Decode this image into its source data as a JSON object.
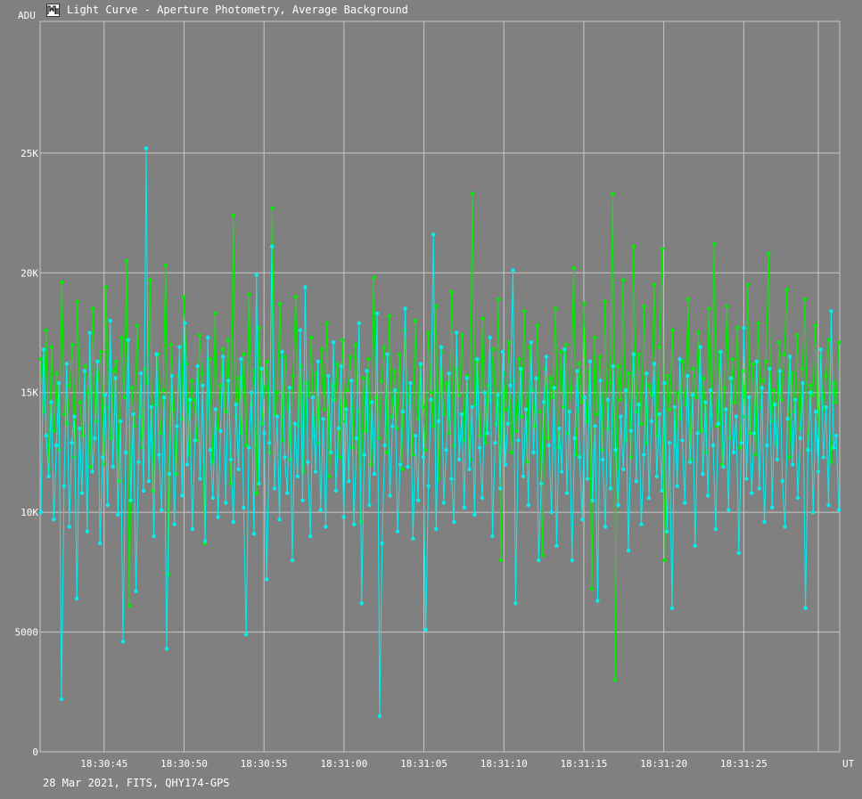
{
  "window": {
    "title": "Light Curve - Aperture Photometry, Average Background",
    "icon": "light-curve-app-icon"
  },
  "footer": {
    "info": "28 Mar 2021, FITS, QHY174-GPS"
  },
  "colors": {
    "background": "#808080",
    "grid": "#c8c8c8",
    "series_green": "#00ee00",
    "series_cyan": "#00f0f0"
  },
  "chart_data": {
    "type": "line",
    "title": "Light Curve - Aperture Photometry, Average Background",
    "ylabel": "ADU",
    "xlabel": "UT",
    "xlim": [
      "18:30:41",
      "18:31:31"
    ],
    "ylim": [
      0,
      30500
    ],
    "grid": true,
    "x_tick_labels": [
      "18:30:45",
      "18:30:50",
      "18:30:55",
      "18:31:00",
      "18:31:05",
      "18:31:10",
      "18:31:15",
      "18:31:20",
      "18:31:25"
    ],
    "y_tick_labels": [
      "0",
      "5000",
      "10K",
      "15K",
      "20K",
      "25K"
    ],
    "y_tick_values": [
      0,
      5000,
      10000,
      15000,
      20000,
      25000
    ],
    "series": [
      {
        "values": [
          16400,
          14200,
          17600,
          11800,
          16900,
          13400,
          15800,
          12600,
          19600,
          14100,
          13700,
          15300,
          17000,
          12300,
          18800,
          14600,
          13200,
          16100,
          15000,
          11900,
          18500,
          13800,
          15600,
          16700,
          12000,
          19400,
          14400,
          13100,
          15900,
          16300,
          11300,
          17300,
          14800,
          20500,
          6100,
          15200,
          13600,
          17800,
          14000,
          12700,
          16000,
          15400,
          19700,
          10900,
          14500,
          16600,
          13300,
          15100,
          20300,
          7400,
          17000,
          14300,
          11600,
          15700,
          13900,
          19000,
          16200,
          12400,
          15500,
          14700,
          13000,
          17400,
          15800,
          8700,
          14600,
          16400,
          12100,
          18300,
          13500,
          15300,
          16800,
          14200,
          17200,
          11200,
          22400,
          14000,
          15600,
          13300,
          16600,
          12800,
          19100,
          14500,
          15900,
          10800,
          17700,
          13700,
          15200,
          16300,
          12500,
          22700,
          14100,
          15000,
          18700,
          13000,
          16500,
          14400,
          12200,
          15700,
          19000,
          13600,
          16100,
          11700,
          15400,
          14900,
          17300,
          13200,
          15800,
          12900,
          16800,
          14300,
          17900,
          11500,
          15300,
          14700,
          16200,
          12300,
          17200,
          13800,
          15100,
          16500,
          12700,
          17000,
          14200,
          9600,
          15600,
          13400,
          16400,
          12000,
          19800,
          14800,
          13100,
          15500,
          16900,
          12500,
          18200,
          14000,
          15900,
          13500,
          16600,
          11800,
          17600,
          14600,
          15200,
          12400,
          18000,
          13900,
          16100,
          14400,
          12600,
          17500,
          15000,
          13600,
          18600,
          11400,
          16700,
          14100,
          15400,
          13300,
          19200,
          12800,
          16000,
          14900,
          17400,
          13000,
          15700,
          12200,
          23300,
          14500,
          16300,
          13200,
          18100,
          12900,
          15300,
          14700,
          16800,
          13700,
          18900,
          8000,
          15800,
          14300,
          17100,
          12500,
          15500,
          13400,
          16400,
          14000,
          18400,
          12100,
          16900,
          15100,
          13600,
          17800,
          14200,
          8200,
          16000,
          13100,
          15600,
          14800,
          18500,
          12700,
          16700,
          14400,
          17000,
          13300,
          15200,
          20200,
          12400,
          16200,
          14600,
          18700,
          13800,
          15900,
          6800,
          17300,
          14100,
          16500,
          12600,
          18800,
          13500,
          15400,
          23300,
          3000,
          16100,
          14700,
          19700,
          13000,
          15800,
          12300,
          21100,
          14200,
          16600,
          13700,
          18600,
          12900,
          15300,
          14900,
          19500,
          13200,
          16900,
          21000,
          8000,
          15700,
          14300,
          17600,
          12800,
          15000,
          13900,
          16300,
          14500,
          18900,
          12200,
          16000,
          14800,
          17500,
          13400,
          15600,
          12500,
          18500,
          14100,
          21200,
          13600,
          16700,
          12000,
          15200,
          18600,
          13100,
          16400,
          14600,
          17700,
          12700,
          15900,
          14000,
          19500,
          13300,
          16200,
          12400,
          17900,
          14400,
          15500,
          16300,
          20800,
          13800,
          15100,
          12900,
          17100,
          14700,
          16600,
          19300,
          12300,
          15800,
          14200,
          17400,
          13500,
          16000,
          18900,
          12600,
          15300,
          14900,
          17800,
          13200,
          16500,
          14300,
          15700,
          17200,
          12100,
          15400,
          14600,
          17100
        ]
      },
      {
        "values": [
          10000,
          16800,
          13200,
          11500,
          14600,
          9700,
          12800,
          15400,
          2200,
          11100,
          16200,
          9400,
          12900,
          14000,
          6400,
          13500,
          10800,
          15900,
          9200,
          17500,
          11700,
          13100,
          16300,
          8700,
          12300,
          14900,
          10300,
          18000,
          11900,
          15600,
          9900,
          13800,
          4600,
          12500,
          17200,
          10500,
          14100,
          6700,
          12100,
          15800,
          10900,
          25200,
          11300,
          14400,
          9000,
          16600,
          12400,
          10100,
          14800,
          4300,
          11600,
          15700,
          9500,
          13600,
          16900,
          10700,
          17900,
          12000,
          14700,
          9300,
          13000,
          16100,
          11400,
          15300,
          8800,
          17300,
          12600,
          10600,
          14300,
          9800,
          13400,
          16500,
          10400,
          15500,
          12200,
          9600,
          14500,
          11800,
          16400,
          10200,
          4900,
          12700,
          15000,
          9100,
          19900,
          11200,
          16000,
          13300,
          7200,
          12900,
          21100,
          11000,
          14000,
          9700,
          16700,
          12300,
          10800,
          15200,
          8000,
          13700,
          11500,
          17600,
          10500,
          19400,
          12100,
          9000,
          14800,
          11700,
          16300,
          10100,
          13900,
          9400,
          15700,
          12500,
          17100,
          10900,
          13500,
          16100,
          9800,
          14300,
          11300,
          15500,
          9500,
          13100,
          17900,
          6200,
          12400,
          15900,
          10300,
          14600,
          11600,
          18300,
          1500,
          8700,
          12800,
          16600,
          10700,
          13600,
          15100,
          9200,
          12000,
          14200,
          18500,
          11900,
          15400,
          8900,
          13200,
          10500,
          16200,
          12300,
          5100,
          11100,
          14700,
          21600,
          9300,
          13800,
          16900,
          10400,
          12600,
          15800,
          11400,
          9600,
          17500,
          12200,
          14100,
          10200,
          15600,
          11800,
          14400,
          9900,
          16400,
          12700,
          10600,
          15000,
          13300,
          17300,
          9000,
          12900,
          14900,
          11000,
          16700,
          12000,
          13700,
          15300,
          20100,
          6200,
          13000,
          16000,
          11500,
          14300,
          10300,
          17100,
          12500,
          15600,
          8000,
          11200,
          14600,
          16500,
          12800,
          10000,
          15200,
          8600,
          13500,
          11700,
          16800,
          10800,
          14200,
          8000,
          13100,
          15900,
          12300,
          9700,
          14800,
          11400,
          16300,
          10500,
          13600,
          6300,
          15500,
          12200,
          9400,
          14700,
          11000,
          16100,
          12600,
          10300,
          14000,
          11800,
          15100,
          8400,
          13400,
          16600,
          11300,
          14500,
          9500,
          12400,
          15800,
          10600,
          13800,
          16200,
          11500,
          14100,
          10900,
          15400,
          9200,
          12900,
          6000,
          14400,
          11100,
          16400,
          13000,
          10400,
          15700,
          12100,
          14900,
          8600,
          13300,
          16900,
          11600,
          14600,
          10700,
          15100,
          12800,
          9300,
          13700,
          16700,
          11900,
          14300,
          10100,
          15600,
          12500,
          14000,
          8300,
          12900,
          17700,
          11400,
          14800,
          10800,
          13300,
          16300,
          11000,
          15200,
          9600,
          12800,
          16000,
          10200,
          14500,
          12200,
          15900,
          11300,
          9400,
          13900,
          16500,
          12000,
          14700,
          10600,
          13100,
          15400,
          6000,
          12600,
          15000,
          10000,
          14200,
          11700,
          16800,
          12300,
          14400,
          10300,
          18400,
          12700,
          13200,
          10100
        ]
      }
    ]
  }
}
